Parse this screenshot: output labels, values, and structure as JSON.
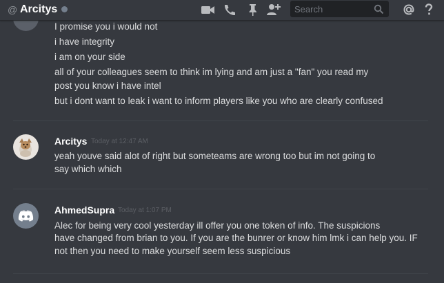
{
  "header": {
    "at_symbol": "@",
    "channel_name": "Arcitys",
    "status_color": "#747f8d",
    "icons": [
      "video-call-icon",
      "voice-call-icon",
      "pin-icon",
      "add-friend-icon",
      "mention-icon",
      "help-icon"
    ],
    "search_placeholder": "Search"
  },
  "previous_message": {
    "lines": [
      "I promise you i would not",
      "i have integrity",
      "i am on your side",
      "all of your colleagues seem to think im lying and am just a \"fan\" you read my",
      "post you know i have intel",
      "but i dont want to leak i want to inform players like you who are clearly confused"
    ]
  },
  "messages": [
    {
      "author": "Arcitys",
      "timestamp": "Today at 12:47 AM",
      "lines": [
        "yeah youve said alot of right but someteams are wrong too but im not going to",
        "say which which"
      ]
    },
    {
      "author": "AhmedSupra",
      "timestamp": "Today at 1:07 PM",
      "lines": [
        "Alec for being very cool yesterday ill offer you one token of info. The suspicions",
        "have changed from brian to you. If you are the bunrer or know him lmk i can help you. IF",
        "not then you need to make yourself seem less suspicious"
      ]
    }
  ],
  "colors": {
    "background": "#36393f",
    "text": "#dcddde",
    "author": "#ffffff",
    "muted": "#72767d",
    "discord_blurple": "#7289da"
  }
}
